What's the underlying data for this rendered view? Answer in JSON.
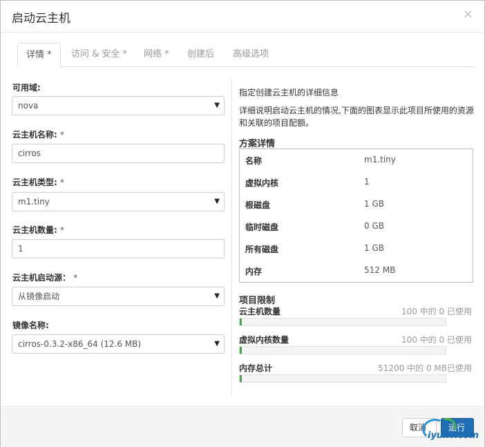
{
  "dialog": {
    "title": "启动云主机",
    "close_glyph": "×"
  },
  "tabs": [
    {
      "label": "详情 *"
    },
    {
      "label": "访问 & 安全 *"
    },
    {
      "label": "网络 *"
    },
    {
      "label": "创建后"
    },
    {
      "label": "高级选项"
    }
  ],
  "form": {
    "availability_zone": {
      "label": "可用域:",
      "value": "nova"
    },
    "instance_name": {
      "label": "云主机名称:",
      "required": "*",
      "value": "cirros"
    },
    "flavor": {
      "label": "云主机类型:",
      "required": "*",
      "value": "m1.tiny"
    },
    "instance_count": {
      "label": "云主机数量:",
      "required": "*",
      "value": "1"
    },
    "boot_source": {
      "label": "云主机启动源：",
      "required": "*",
      "value": "从镜像启动"
    },
    "image_name": {
      "label": "镜像名称:",
      "value": "cirros-0.3.2-x86_64 (12.6 MB)"
    }
  },
  "info": {
    "title": "指定创建云主机的详细信息",
    "description": "详细说明启动云主机的情况,下面的图表显示此项目所使用的资源和关联的项目配额。"
  },
  "flavor_details": {
    "heading": "方案详情",
    "rows": [
      {
        "key": "名称",
        "value": "m1.tiny"
      },
      {
        "key": "虚拟内核",
        "value": "1"
      },
      {
        "key": "根磁盘",
        "value": "1 GB"
      },
      {
        "key": "临时磁盘",
        "value": "0 GB"
      },
      {
        "key": "所有磁盘",
        "value": "1 GB"
      },
      {
        "key": "内存",
        "value": "512 MB"
      }
    ]
  },
  "project_limits": {
    "heading": "项目限制",
    "quotas": [
      {
        "label": "云主机数量",
        "usage": "100 中的 0 已使用",
        "fraction": 0
      },
      {
        "label": "虚拟内核数量",
        "usage": "100 中的 0 已使用",
        "fraction": 0
      },
      {
        "label": "内存总计",
        "usage": "51200 中的 0 MB已使用",
        "fraction": 0
      }
    ]
  },
  "footer": {
    "cancel_label": "取消",
    "launch_label": "运行"
  },
  "watermark": {
    "text": "iyunv.com"
  },
  "colors": {
    "primary": "#1f6eb5",
    "quota_fill": "#47a447"
  }
}
